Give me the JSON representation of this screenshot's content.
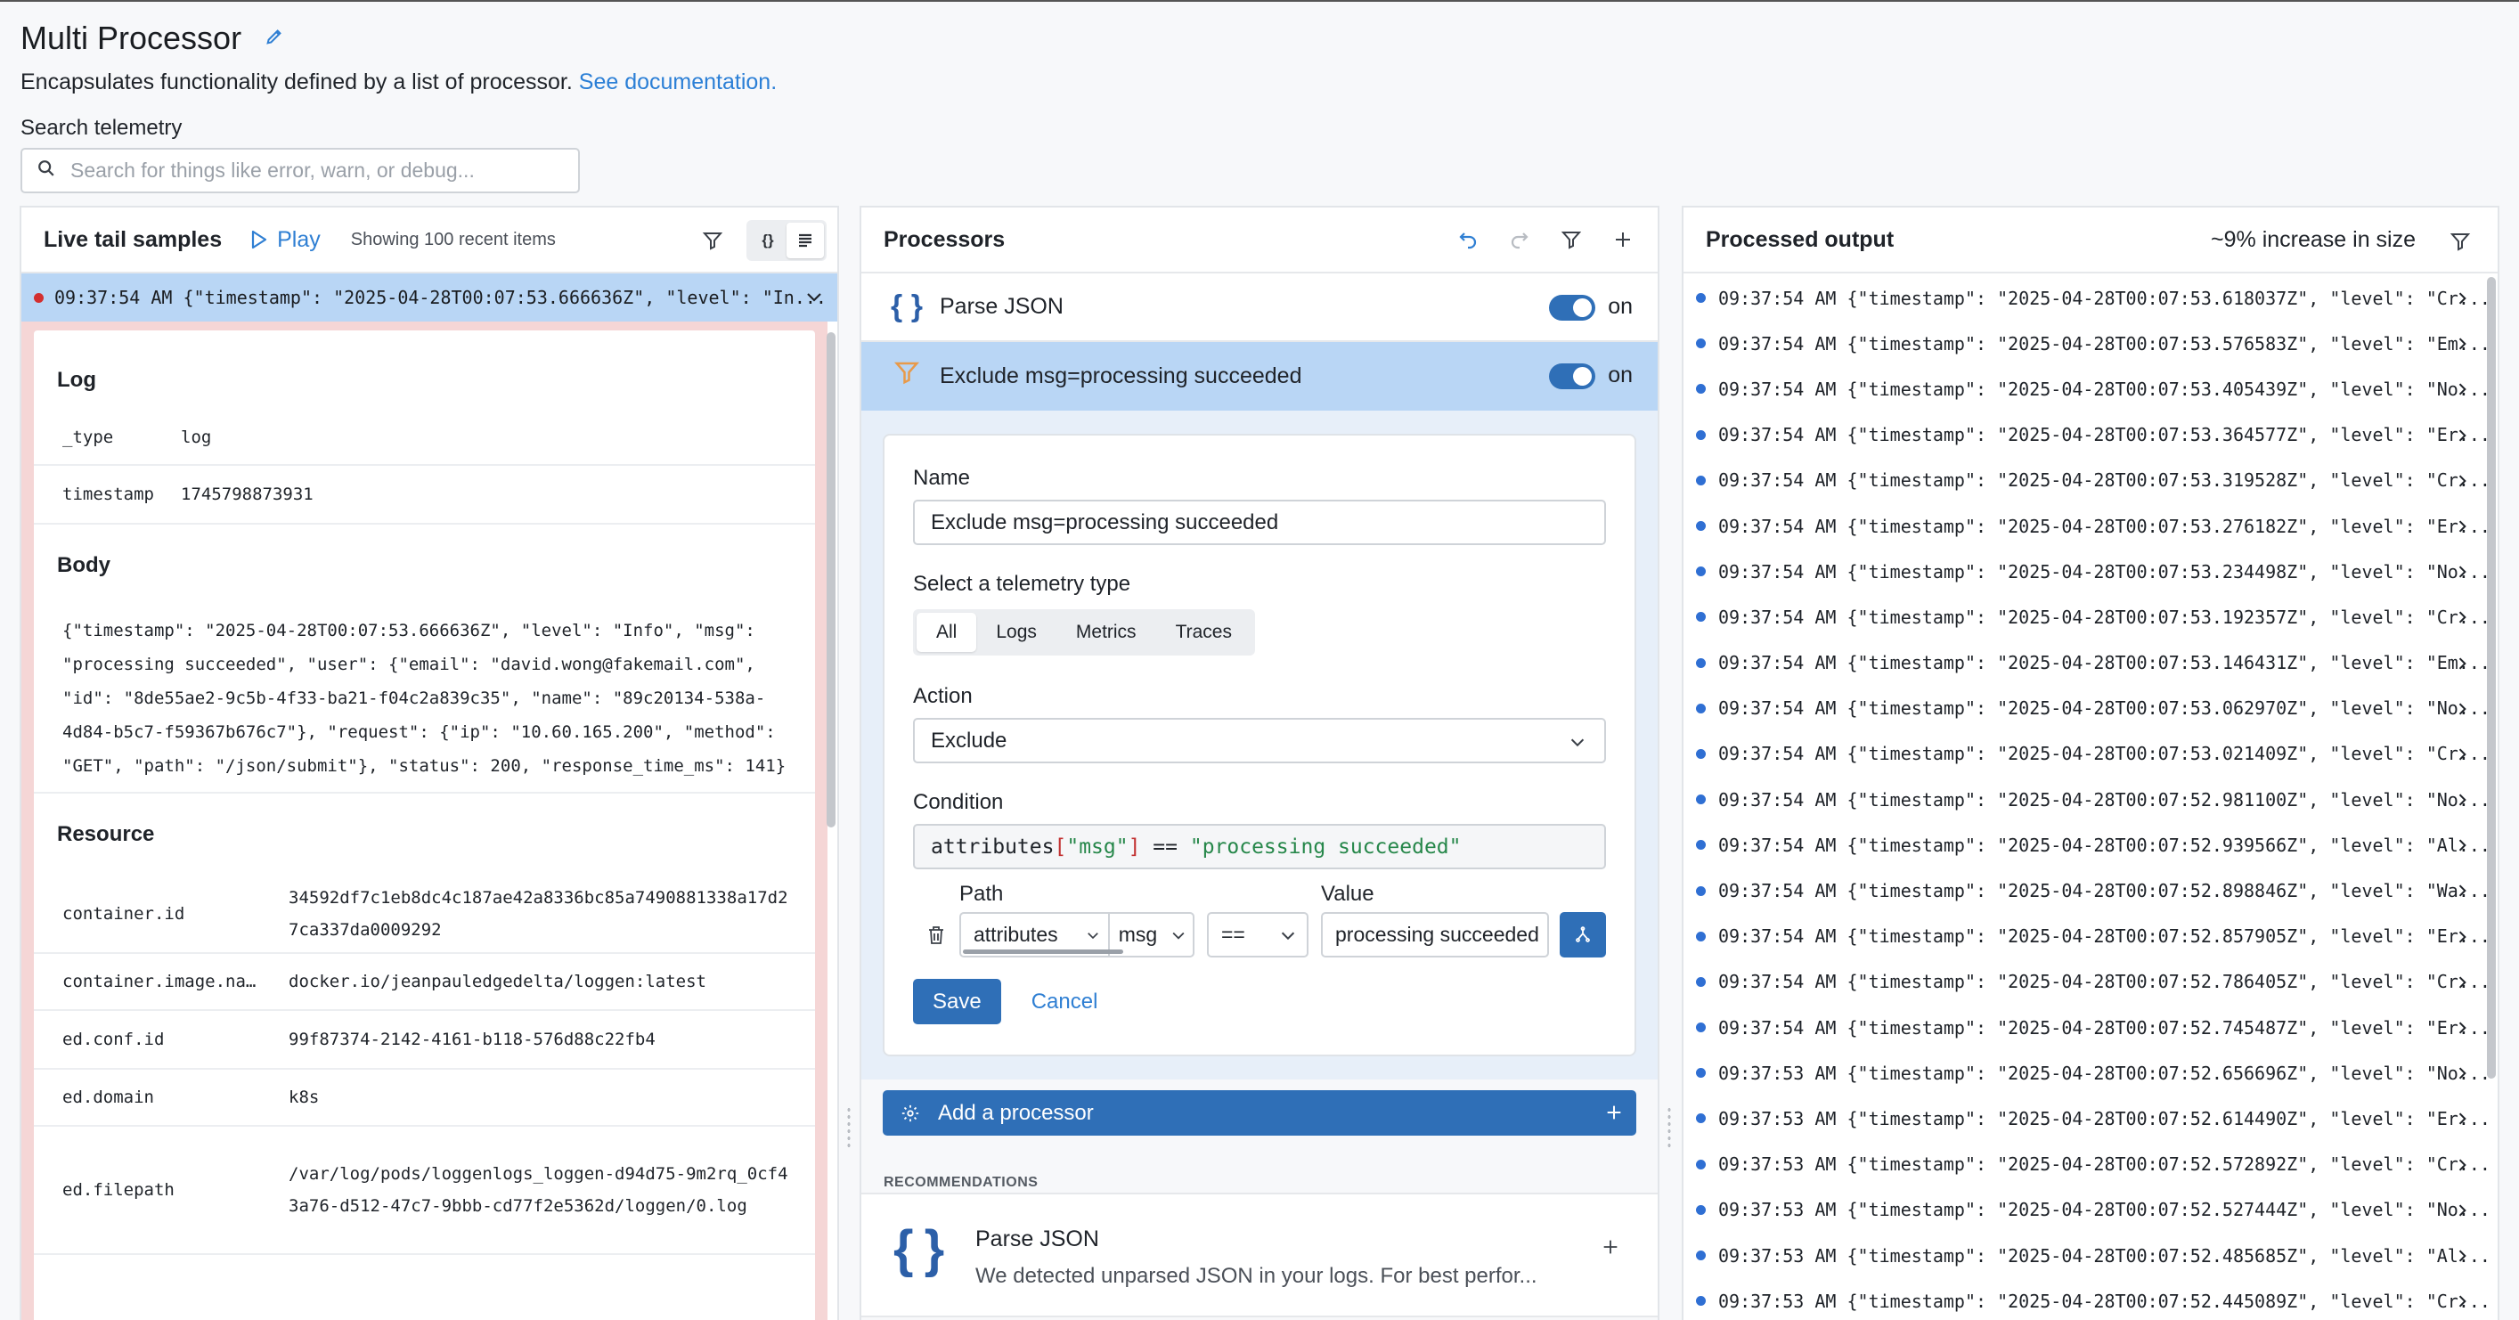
{
  "header": {
    "title": "Multi Processor",
    "description": "Encapsulates functionality defined by a list of processor.",
    "doc_link": "See documentation.",
    "search_label": "Search telemetry",
    "search_placeholder": "Search for things like error, warn, or debug..."
  },
  "left": {
    "title": "Live tail samples",
    "play_label": "Play",
    "showing": "Showing 100 recent items",
    "json_toggle": "{}",
    "selected_row": "09:37:54 AM {\"timestamp\": \"2025-04-28T00:07:53.666636Z\", \"level\": \"In...",
    "log_heading": "Log",
    "log_fields": [
      {
        "k": "_type",
        "v": "log"
      },
      {
        "k": "timestamp",
        "v": "1745798873931"
      }
    ],
    "body_heading": "Body",
    "body": "{\"timestamp\": \"2025-04-28T00:07:53.666636Z\", \"level\": \"Info\", \"msg\": \"processing succeeded\", \"user\": {\"email\": \"david.wong@fakemail.com\", \"id\": \"8de55ae2-9c5b-4f33-ba21-f04c2a839c35\", \"name\": \"89c20134-538a-4d84-b5c7-f59367b676c7\"}, \"request\": {\"ip\": \"10.60.165.200\", \"method\": \"GET\", \"path\": \"/json/submit\"}, \"status\": 200, \"response_time_ms\": 141}",
    "resource_heading": "Resource",
    "resource_fields": [
      {
        "k": "container.id",
        "v": "34592df7c1eb8dc4c187ae42a8336bc85a7490881338a17d27ca337da0009292"
      },
      {
        "k": "container.image.na…",
        "v": "docker.io/jeanpauledgedelta/loggen:latest"
      },
      {
        "k": "ed.conf.id",
        "v": "99f87374-2142-4161-b118-576d88c22fb4"
      },
      {
        "k": "ed.domain",
        "v": "k8s"
      },
      {
        "k": "ed.filepath",
        "v": "/var/log/pods/loggenlogs_loggen-d94d75-9m2rq_0cf43a76-d512-47c7-9bbb-cd77f2e5362d/loggen/0.log"
      }
    ]
  },
  "middle": {
    "title": "Processors",
    "processors": [
      {
        "icon": "{ }",
        "name": "Parse JSON",
        "state": "on"
      },
      {
        "icon": "filter",
        "name": "Exclude msg=processing succeeded",
        "state": "on"
      }
    ],
    "form": {
      "name_label": "Name",
      "name_value": "Exclude msg=processing succeeded",
      "type_label": "Select a telemetry type",
      "types": [
        "All",
        "Logs",
        "Metrics",
        "Traces"
      ],
      "action_label": "Action",
      "action_value": "Exclude",
      "condition_label": "Condition",
      "condition": {
        "p1": "attributes",
        "p2": "[",
        "p3": "\"msg\"",
        "p4": "]",
        "p5": " == ",
        "p6": "\"processing succeeded\""
      },
      "path_label": "Path",
      "value_label": "Value",
      "path_a": "attributes",
      "path_b": "msg",
      "operator": "==",
      "value": "processing succeeded",
      "save": "Save",
      "cancel": "Cancel"
    },
    "add_processor": "Add a processor",
    "recs_label": "RECOMMENDATIONS",
    "rec": {
      "icon": "{ }",
      "title": "Parse JSON",
      "desc": "We detected unparsed JSON in your logs. For best perfor..."
    }
  },
  "right": {
    "title": "Processed output",
    "size_note": "~9% increase in size",
    "rows": [
      "09:37:54 AM {\"timestamp\": \"2025-04-28T00:07:53.618037Z\", \"level\": \"Cr...",
      "09:37:54 AM {\"timestamp\": \"2025-04-28T00:07:53.576583Z\", \"level\": \"Em...",
      "09:37:54 AM {\"timestamp\": \"2025-04-28T00:07:53.405439Z\", \"level\": \"No...",
      "09:37:54 AM {\"timestamp\": \"2025-04-28T00:07:53.364577Z\", \"level\": \"Er...",
      "09:37:54 AM {\"timestamp\": \"2025-04-28T00:07:53.319528Z\", \"level\": \"Cr...",
      "09:37:54 AM {\"timestamp\": \"2025-04-28T00:07:53.276182Z\", \"level\": \"Er...",
      "09:37:54 AM {\"timestamp\": \"2025-04-28T00:07:53.234498Z\", \"level\": \"No...",
      "09:37:54 AM {\"timestamp\": \"2025-04-28T00:07:53.192357Z\", \"level\": \"Cr...",
      "09:37:54 AM {\"timestamp\": \"2025-04-28T00:07:53.146431Z\", \"level\": \"Em...",
      "09:37:54 AM {\"timestamp\": \"2025-04-28T00:07:53.062970Z\", \"level\": \"No...",
      "09:37:54 AM {\"timestamp\": \"2025-04-28T00:07:53.021409Z\", \"level\": \"Cr...",
      "09:37:54 AM {\"timestamp\": \"2025-04-28T00:07:52.981100Z\", \"level\": \"No...",
      "09:37:54 AM {\"timestamp\": \"2025-04-28T00:07:52.939566Z\", \"level\": \"Al...",
      "09:37:54 AM {\"timestamp\": \"2025-04-28T00:07:52.898846Z\", \"level\": \"Wa...",
      "09:37:54 AM {\"timestamp\": \"2025-04-28T00:07:52.857905Z\", \"level\": \"Er...",
      "09:37:54 AM {\"timestamp\": \"2025-04-28T00:07:52.786405Z\", \"level\": \"Cr...",
      "09:37:54 AM {\"timestamp\": \"2025-04-28T00:07:52.745487Z\", \"level\": \"Er...",
      "09:37:53 AM {\"timestamp\": \"2025-04-28T00:07:52.656696Z\", \"level\": \"No...",
      "09:37:53 AM {\"timestamp\": \"2025-04-28T00:07:52.614490Z\", \"level\": \"Er...",
      "09:37:53 AM {\"timestamp\": \"2025-04-28T00:07:52.572892Z\", \"level\": \"Cr...",
      "09:37:53 AM {\"timestamp\": \"2025-04-28T00:07:52.527444Z\", \"level\": \"No...",
      "09:37:53 AM {\"timestamp\": \"2025-04-28T00:07:52.485685Z\", \"level\": \"Al...",
      "09:37:53 AM {\"timestamp\": \"2025-04-28T00:07:52.445089Z\", \"level\": \"Cr..."
    ]
  },
  "colors": {
    "accent": "#2f6fb7",
    "link": "#2b7fd6",
    "selected": "#b9d6f5",
    "error_dot": "#d32f2f"
  }
}
